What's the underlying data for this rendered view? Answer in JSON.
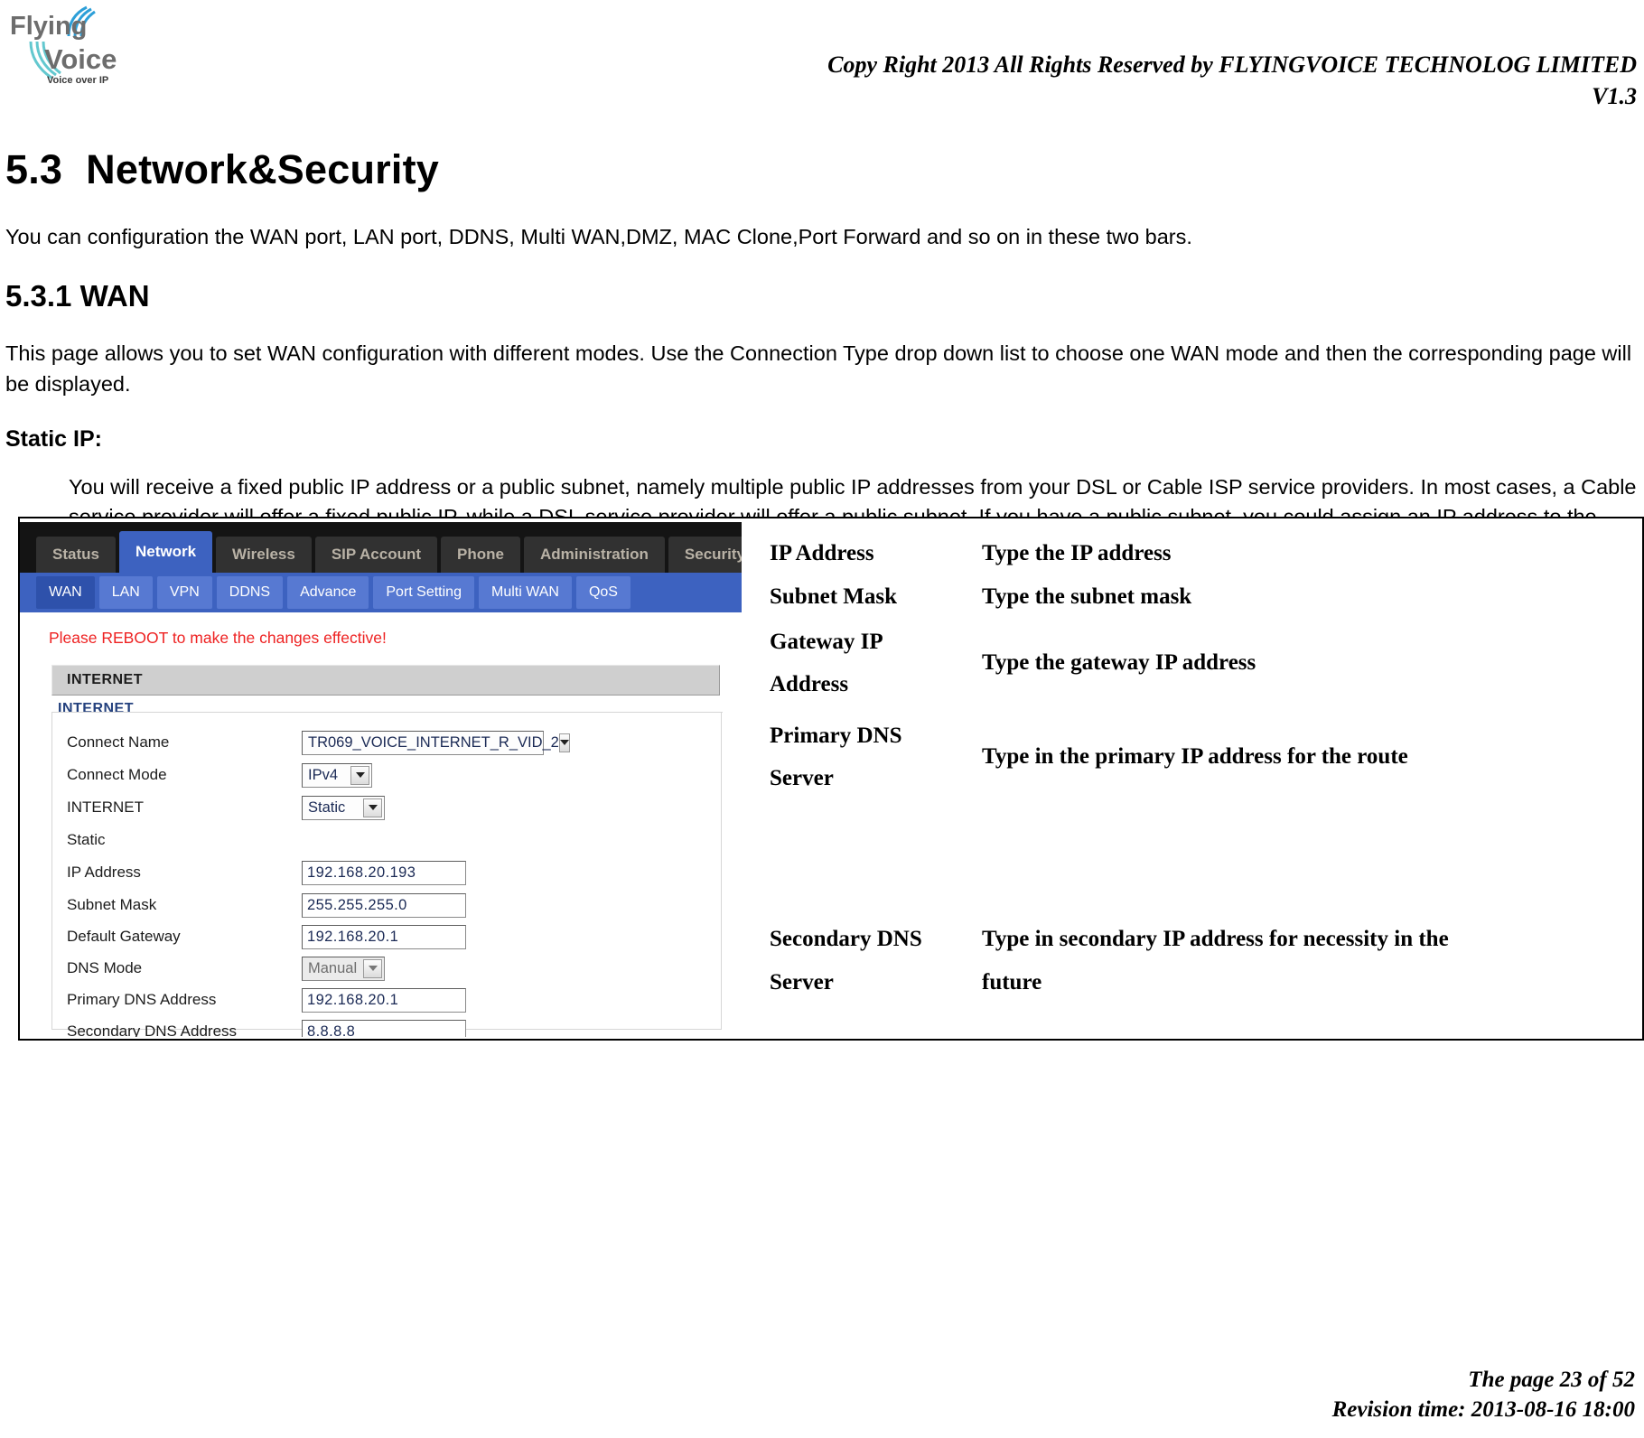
{
  "header": {
    "logo_top": "Flying",
    "logo_bottom": "Voice",
    "logo_tagline": "Voice over IP",
    "copyright": "Copy Right 2013 All Rights Reserved by FLYINGVOICE TECHNOLOG LIMITED",
    "version": "V1.3"
  },
  "doc": {
    "section_number": "5.3",
    "section_title": "Network&Security",
    "intro": "You can configuration the WAN port, LAN port, DDNS, Multi WAN,DMZ, MAC Clone,Port Forward and so on in these two bars.",
    "subsection_title": "5.3.1 WAN",
    "subsection_body": "This page allows you to set WAN configuration with different modes. Use the Connection Type drop down list to choose one WAN mode and then the corresponding page will be displayed.",
    "static_ip_heading": "Static IP:",
    "static_ip_body": "You will receive a fixed public IP address or a public subnet, namely multiple public IP addresses from your DSL or Cable ISP service providers. In most cases, a Cable service provider will offer a fixed public IP, while a DSL service provider will offer a public subnet. If you have a public subnet, you could assign an IP address to the WAN interface."
  },
  "router": {
    "main_tabs": [
      {
        "label": "Status",
        "active": false
      },
      {
        "label": "Network",
        "active": true
      },
      {
        "label": "Wireless",
        "active": false
      },
      {
        "label": "SIP Account",
        "active": false
      },
      {
        "label": "Phone",
        "active": false
      },
      {
        "label": "Administration",
        "active": false
      },
      {
        "label": "Security",
        "active": false
      }
    ],
    "sub_tabs": [
      {
        "label": "WAN",
        "active": true
      },
      {
        "label": "LAN",
        "active": false
      },
      {
        "label": "VPN",
        "active": false
      },
      {
        "label": "DDNS",
        "active": false
      },
      {
        "label": "Advance",
        "active": false
      },
      {
        "label": "Port Setting",
        "active": false
      },
      {
        "label": "Multi WAN",
        "active": false
      },
      {
        "label": "QoS",
        "active": false
      }
    ],
    "reboot_message": "Please REBOOT to make the changes effective!",
    "panel_title": "INTERNET",
    "fieldset_legend": "INTERNET",
    "fields": {
      "connect_name_label": "Connect Name",
      "connect_name_value": "TR069_VOICE_INTERNET_R_VID_2",
      "connect_mode_label": "Connect Mode",
      "connect_mode_value": "IPv4",
      "internet_label": "INTERNET",
      "internet_value": "Static",
      "static_label": "Static",
      "ip_address_label": "IP Address",
      "ip_address_value": "192.168.20.193",
      "subnet_mask_label": "Subnet Mask",
      "subnet_mask_value": "255.255.255.0",
      "default_gateway_label": "Default Gateway",
      "default_gateway_value": "192.168.20.1",
      "dns_mode_label": "DNS Mode",
      "dns_mode_value": "Manual",
      "primary_dns_label": "Primary DNS Address",
      "primary_dns_value": "192.168.20.1",
      "secondary_dns_label": "Secondary DNS Address",
      "secondary_dns_value": "8.8.8.8"
    },
    "colors": {
      "nav_bar": "#141414",
      "active_tab": "#3d62c0",
      "sub_bar": "#3d62c0",
      "reboot_text": "#ee2222",
      "panel_header": "#cfcfcf"
    }
  },
  "descriptions": [
    {
      "term": "IP Address",
      "term2": "",
      "def": "Type the IP address",
      "def2": ""
    },
    {
      "term": "Subnet Mask",
      "term2": "",
      "def": "Type the subnet mask",
      "def2": ""
    },
    {
      "term": "Gateway IP",
      "term2": "Address",
      "def": "Type the gateway IP address",
      "def2": ""
    },
    {
      "term": "Primary DNS",
      "term2": "Server",
      "def": "Type in the primary IP address for the route",
      "def2": ""
    },
    {
      "term": "Secondary DNS",
      "term2": "Server",
      "def": "Type in secondary IP address for necessity in the",
      "def2": "future"
    }
  ],
  "footer": {
    "page": "The page 23 of 52",
    "revision": "Revision time: 2013-08-16 18:00"
  }
}
